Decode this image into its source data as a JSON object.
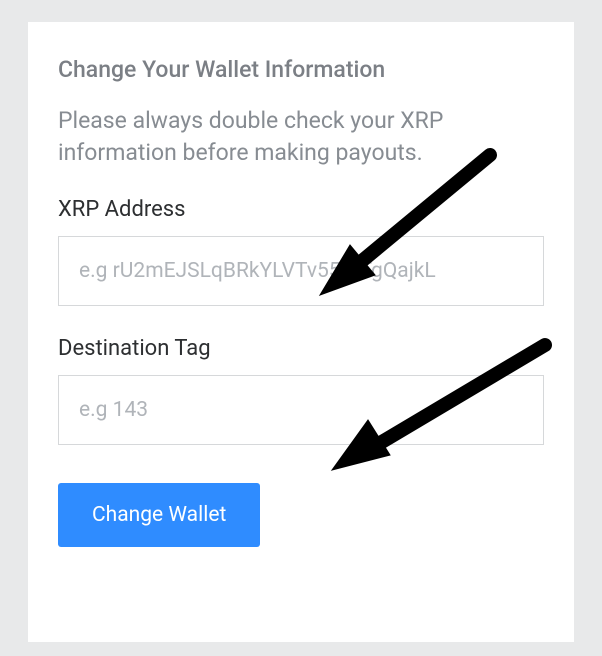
{
  "form": {
    "title": "Change Your Wallet Information",
    "instructions": "Please always double check your XRP information before making payouts.",
    "address": {
      "label": "XRP Address",
      "placeholder": "e.g rU2mEJSLqBRkYLVTv55rFTgQajkL",
      "value": ""
    },
    "tag": {
      "label": "Destination Tag",
      "placeholder": "e.g 143",
      "value": ""
    },
    "submit_label": "Change Wallet"
  }
}
